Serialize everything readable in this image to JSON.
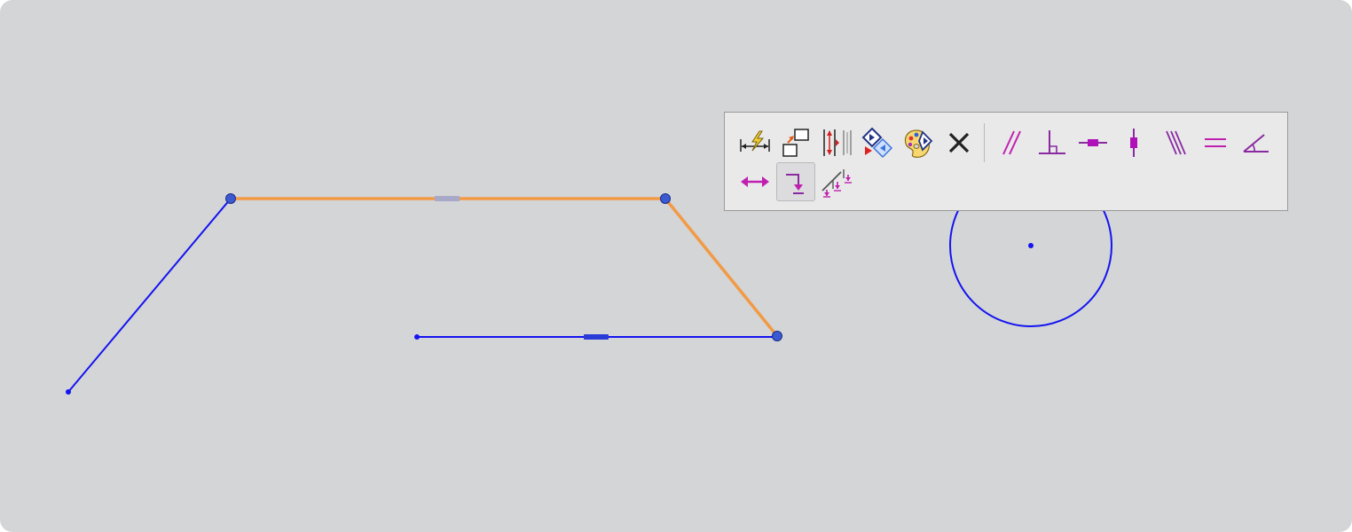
{
  "window": {
    "title": ""
  },
  "colors": {
    "canvas_background": "#d4d5d7",
    "sketch_line": "#1414f0",
    "selected_line": "#f29a45",
    "constraint": "#c020b0"
  },
  "toolbar": {
    "row1": [
      {
        "id": "smart-dimension",
        "icon": "smart-dimension-icon"
      },
      {
        "id": "relate",
        "icon": "relate-icon"
      },
      {
        "id": "dimension-vertical",
        "icon": "dimension-vertical-icon"
      },
      {
        "id": "drive-dimension",
        "icon": "drive-dimension-icon"
      },
      {
        "id": "display-options",
        "icon": "palette-icon"
      },
      {
        "id": "delete",
        "icon": "close-icon"
      }
    ],
    "constraints": [
      {
        "id": "parallel",
        "icon": "parallel-icon"
      },
      {
        "id": "perpendicular",
        "icon": "perpendicular-icon"
      },
      {
        "id": "horizontal",
        "icon": "horizontal-icon"
      },
      {
        "id": "vertical",
        "icon": "vertical-icon"
      },
      {
        "id": "collinear",
        "icon": "collinear-icon"
      },
      {
        "id": "equal",
        "icon": "equal-icon"
      },
      {
        "id": "angle",
        "icon": "angle-icon"
      }
    ],
    "row2": [
      {
        "id": "symmetric",
        "icon": "symmetric-arrow-icon"
      },
      {
        "id": "point-on-curve",
        "icon": "point-on-curve-icon",
        "active": true
      },
      {
        "id": "tangent",
        "icon": "tangent-icon"
      }
    ]
  }
}
